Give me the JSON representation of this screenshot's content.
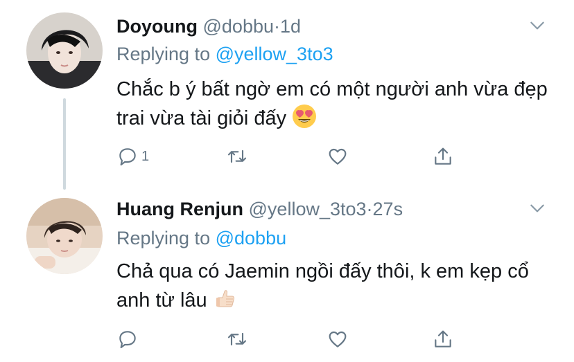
{
  "tweets": [
    {
      "display_name": "Doyoung",
      "handle": "@dobbu",
      "separator": "·",
      "time": "1d",
      "replying_label": "Replying to",
      "replying_to": "@yellow_3to3",
      "text": "Chắc b ý bất ngờ em có một người anh vừa đẹp trai vừa tài giỏi đấy",
      "emoji": "heart-eyes-emoji",
      "reply_count": "1",
      "retweet_count": "",
      "like_count": ""
    },
    {
      "display_name": "Huang Renjun",
      "handle": "@yellow_3to3",
      "separator": "·",
      "time": "27s",
      "replying_label": "Replying to",
      "replying_to": "@dobbu",
      "text": "Chả qua có Jaemin ngồi đấy thôi, k em kẹp cổ anh từ lâu",
      "emoji": "thumbs-up-emoji",
      "reply_count": "",
      "retweet_count": "",
      "like_count": ""
    }
  ],
  "colors": {
    "text": "#14171a",
    "secondary": "#657786",
    "link": "#1da1f2",
    "thread_line": "#cfd9de"
  }
}
